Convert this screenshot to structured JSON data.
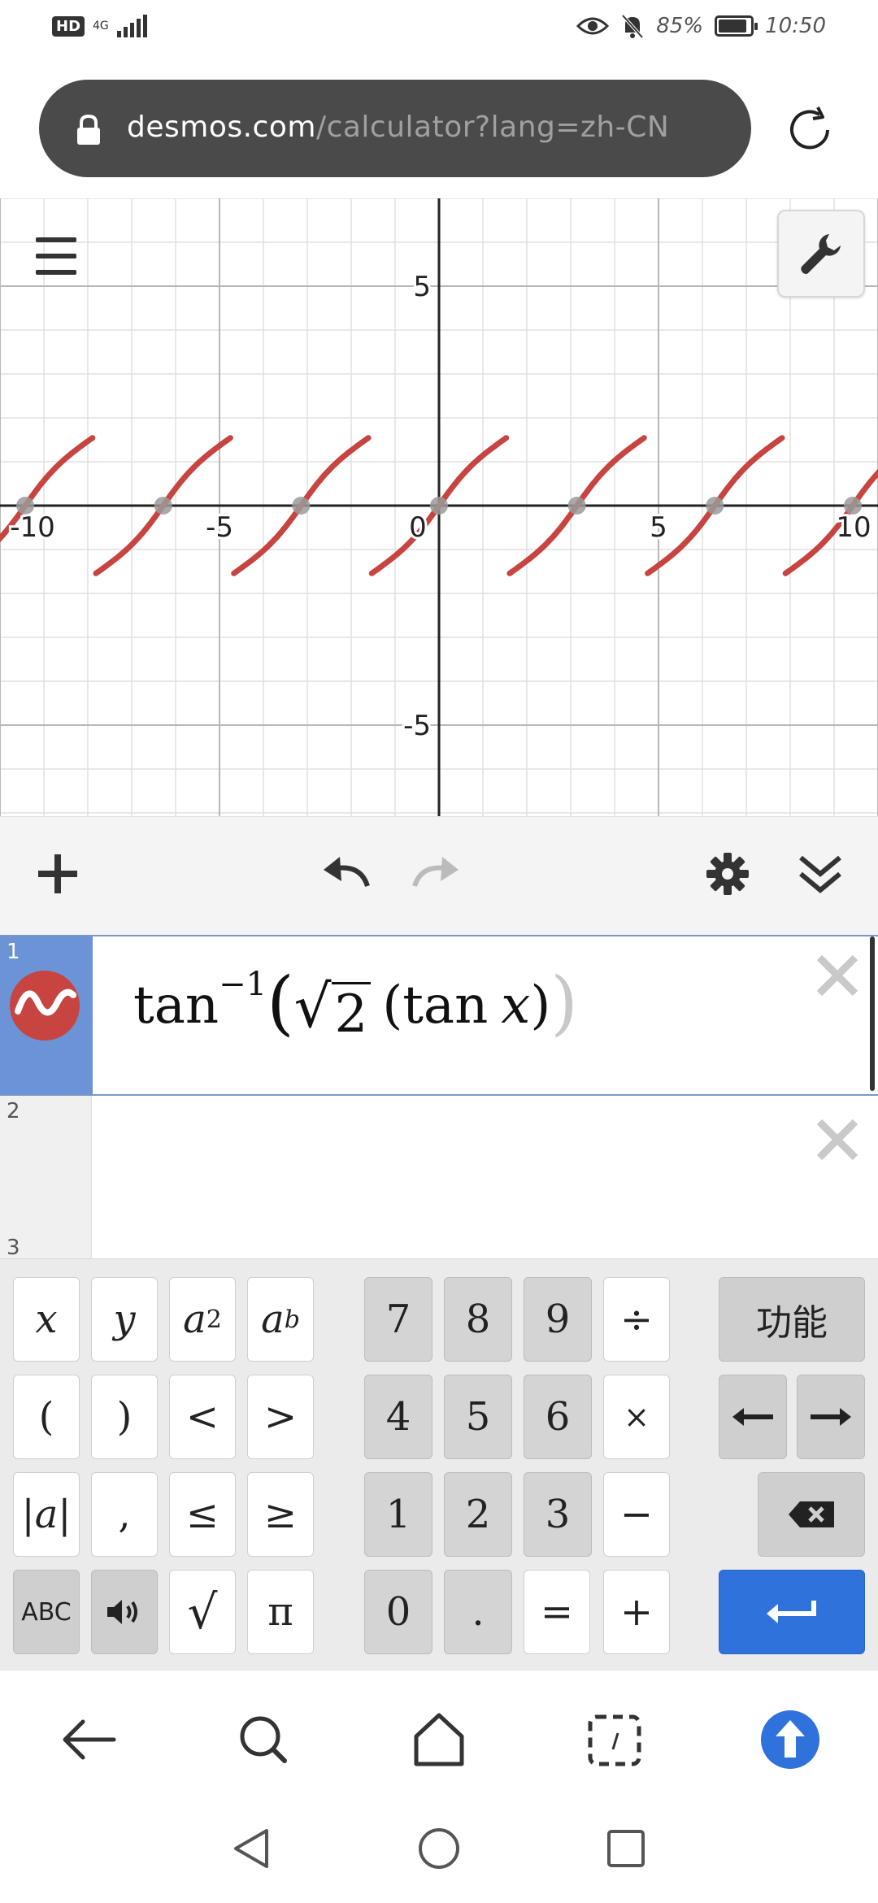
{
  "status_bar": {
    "hd": "HD",
    "network": "4G",
    "battery": "85%",
    "time": "10:50"
  },
  "url_bar": {
    "host": "desmos.com",
    "path": "/calculator?lang=zh-CN"
  },
  "graph": {
    "x_ticks": [
      "-10",
      "-5",
      "0",
      "5",
      "10"
    ],
    "y_ticks": [
      "5",
      "-5"
    ],
    "curve_color": "#c74440",
    "xlim": [
      -10,
      10
    ],
    "ylim": [
      -7,
      7
    ]
  },
  "expressions": [
    {
      "index": "1",
      "latex_parts": {
        "fn": "tan",
        "exp": "−1",
        "root": "2",
        "inner_fn": "tan",
        "var": "x"
      }
    },
    {
      "index": "2"
    },
    {
      "index": "3"
    }
  ],
  "keypad": {
    "func_label": "功能",
    "abc_label": "ABC",
    "keys": {
      "x": "x",
      "y": "y",
      "a2_base": "a",
      "a2_exp": "2",
      "ab_base": "a",
      "ab_exp": "b",
      "lp": "(",
      "rp": ")",
      "lt": "<",
      "gt": ">",
      "abs": "|a|",
      "comma": ",",
      "le": "≤",
      "ge": "≥",
      "sqrt": "√",
      "pi": "π",
      "n7": "7",
      "n8": "8",
      "n9": "9",
      "div": "÷",
      "n4": "4",
      "n5": "5",
      "n6": "6",
      "mul": "×",
      "n1": "1",
      "n2": "2",
      "n3": "3",
      "minus": "−",
      "n0": "0",
      "dot": ".",
      "eq": "=",
      "plus": "+"
    }
  },
  "colors": {
    "accent_blue": "#2f72dc",
    "expr_tab": "#6b93d6",
    "curve": "#c74440"
  }
}
